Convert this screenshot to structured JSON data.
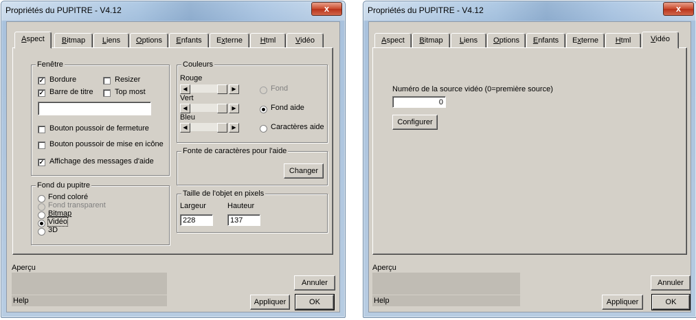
{
  "windows": [
    {
      "title": "Propriétés du PUPITRE - V4.12",
      "close": "x",
      "tabs": [
        {
          "label": "Aspect",
          "ul": "A",
          "rest": "spect"
        },
        {
          "label": "Bitmap",
          "ul": "B",
          "rest": "itmap"
        },
        {
          "label": "Liens",
          "ul": "L",
          "rest": "iens"
        },
        {
          "label": "Options",
          "ul": "O",
          "rest": "ptions"
        },
        {
          "label": "Enfants",
          "ul": "E",
          "rest": "nfants"
        },
        {
          "label": "Externe",
          "pre": "E",
          "ul": "x",
          "rest": "terne"
        },
        {
          "label": "Html",
          "ul": "H",
          "rest": "tml"
        },
        {
          "label": "Vidéo",
          "ul": "V",
          "rest": "idéo"
        }
      ],
      "active_tab": "Aspect",
      "fenetre": {
        "title": "Fenêtre",
        "bordure": "Bordure",
        "resizer": "Resizer",
        "barre": "Barre de titre",
        "topmost": "Top most",
        "bouton_fermeture": "Bouton poussoir de fermeture",
        "bouton_icone": "Bouton poussoir de mise en icône",
        "affichage": "Affichage des messages d'aide",
        "title_field": ""
      },
      "fond": {
        "title": "Fond du pupitre",
        "options": [
          "Fond coloré",
          "Fond transparent",
          "Bitmap",
          "Vidéo",
          "3D"
        ],
        "selected": "Vidéo"
      },
      "couleurs": {
        "title": "Couleurs",
        "rouge": "Rouge",
        "vert": "Vert",
        "bleu": "Bleu",
        "fond": "Fond",
        "fond_aide": "Fond aide",
        "caracteres_aide": "Caractères aide",
        "selected": "Fond aide"
      },
      "fonte": {
        "title": "Fonte de caractères pour l'aide",
        "changer": "Changer"
      },
      "taille": {
        "title": "Taille de l'objet en pixels",
        "largeur": "Largeur",
        "hauteur": "Hauteur",
        "largeur_value": "228",
        "hauteur_value": "137"
      },
      "apercu": "Aperçu",
      "help": "Help",
      "annuler": "Annuler",
      "appliquer": "Appliquer",
      "ok": "OK"
    },
    {
      "title": "Propriétés du PUPITRE - V4.12",
      "close": "x",
      "active_tab": "Vidéo",
      "video": {
        "label": "Numéro de la source vidéo (0=première source)",
        "value": "0",
        "configurer": "Configurer"
      },
      "apercu": "Aperçu",
      "help": "Help",
      "annuler": "Annuler",
      "appliquer": "Appliquer",
      "ok": "OK"
    }
  ]
}
